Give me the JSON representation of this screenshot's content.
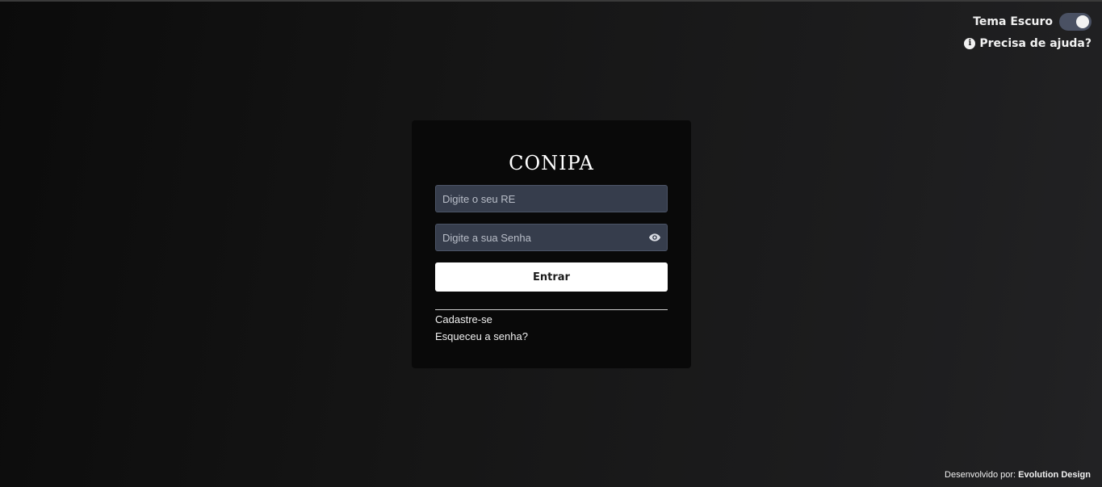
{
  "header": {
    "theme_label": "Tema Escuro",
    "theme_toggle_state": "on",
    "help_label": "Precisa de ajuda?",
    "help_icon": "info-circle-icon"
  },
  "login": {
    "logo_text": "CONIPA",
    "re_placeholder": "Digite o seu RE",
    "re_value": "",
    "password_placeholder": "Digite a sua Senha",
    "password_value": "",
    "show_password_icon": "eye-icon",
    "submit_label": "Entrar",
    "register_link": "Cadastre-se",
    "forgot_link": "Esqueceu a senha?"
  },
  "footer": {
    "prefix": "Desenvolvido por:",
    "brand": "Evolution Design"
  },
  "colors": {
    "card_background": "#090909",
    "input_background": "#363d4c",
    "button_background": "#ffffff",
    "toggle_track": "#4a5163"
  }
}
